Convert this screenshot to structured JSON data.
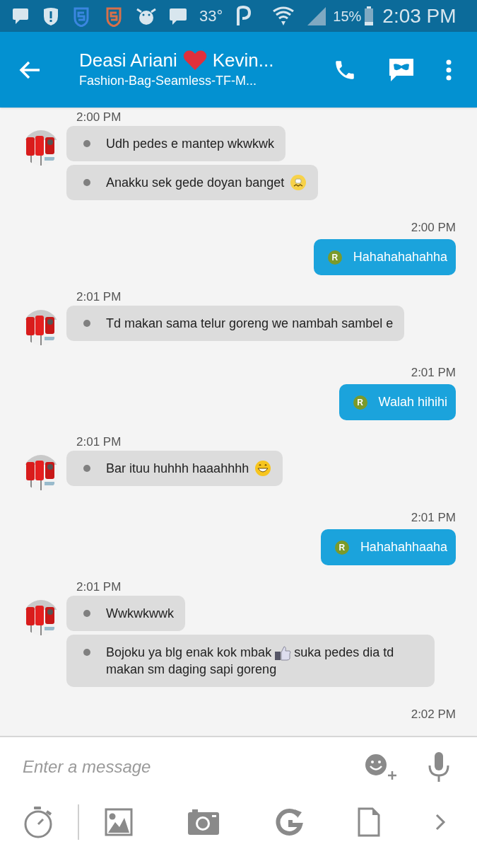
{
  "status_bar": {
    "temperature": "33°",
    "battery": "15%",
    "time": "2:03 PM"
  },
  "header": {
    "title": "Deasi Ariani",
    "title_after": "Kevin...",
    "subtitle": "Fashion-Bag-Seamless-TF-M..."
  },
  "groups": [
    {
      "kind": "received",
      "time": "2:00 PM",
      "messages": [
        {
          "kind": "plain",
          "text": "Udh pedes e mantep wkwkwk"
        },
        {
          "kind": "grimace",
          "text": "Anakku sek gede doyan banget"
        }
      ]
    },
    {
      "kind": "sent",
      "time": "2:00 PM",
      "messages": [
        {
          "badge": "R",
          "text": "Hahahahahahha"
        }
      ]
    },
    {
      "kind": "received",
      "time": "2:01 PM",
      "messages": [
        {
          "kind": "plain",
          "text": "Td makan sama telur goreng we nambah sambel e"
        }
      ]
    },
    {
      "kind": "sent",
      "time": "2:01 PM",
      "messages": [
        {
          "badge": "R",
          "text": "Walah hihihi"
        }
      ]
    },
    {
      "kind": "received",
      "time": "2:01 PM",
      "messages": [
        {
          "kind": "grin",
          "text": "Bar ituu huhhh haaahhhh"
        }
      ]
    },
    {
      "kind": "sent",
      "time": "2:01 PM",
      "messages": [
        {
          "badge": "R",
          "text": "Hahahahhaaha"
        }
      ]
    },
    {
      "kind": "received",
      "time": "2:01 PM",
      "messages": [
        {
          "kind": "plain",
          "text": "Wwkwkwwk"
        },
        {
          "kind": "thumb",
          "text": "Bojoku ya blg enak kok mbak",
          "text_after": "suka pedes dia td makan sm daging sapi goreng"
        }
      ]
    },
    {
      "kind": "sent",
      "time": "2:02 PM"
    }
  ],
  "composer": {
    "placeholder": "Enter a message"
  }
}
